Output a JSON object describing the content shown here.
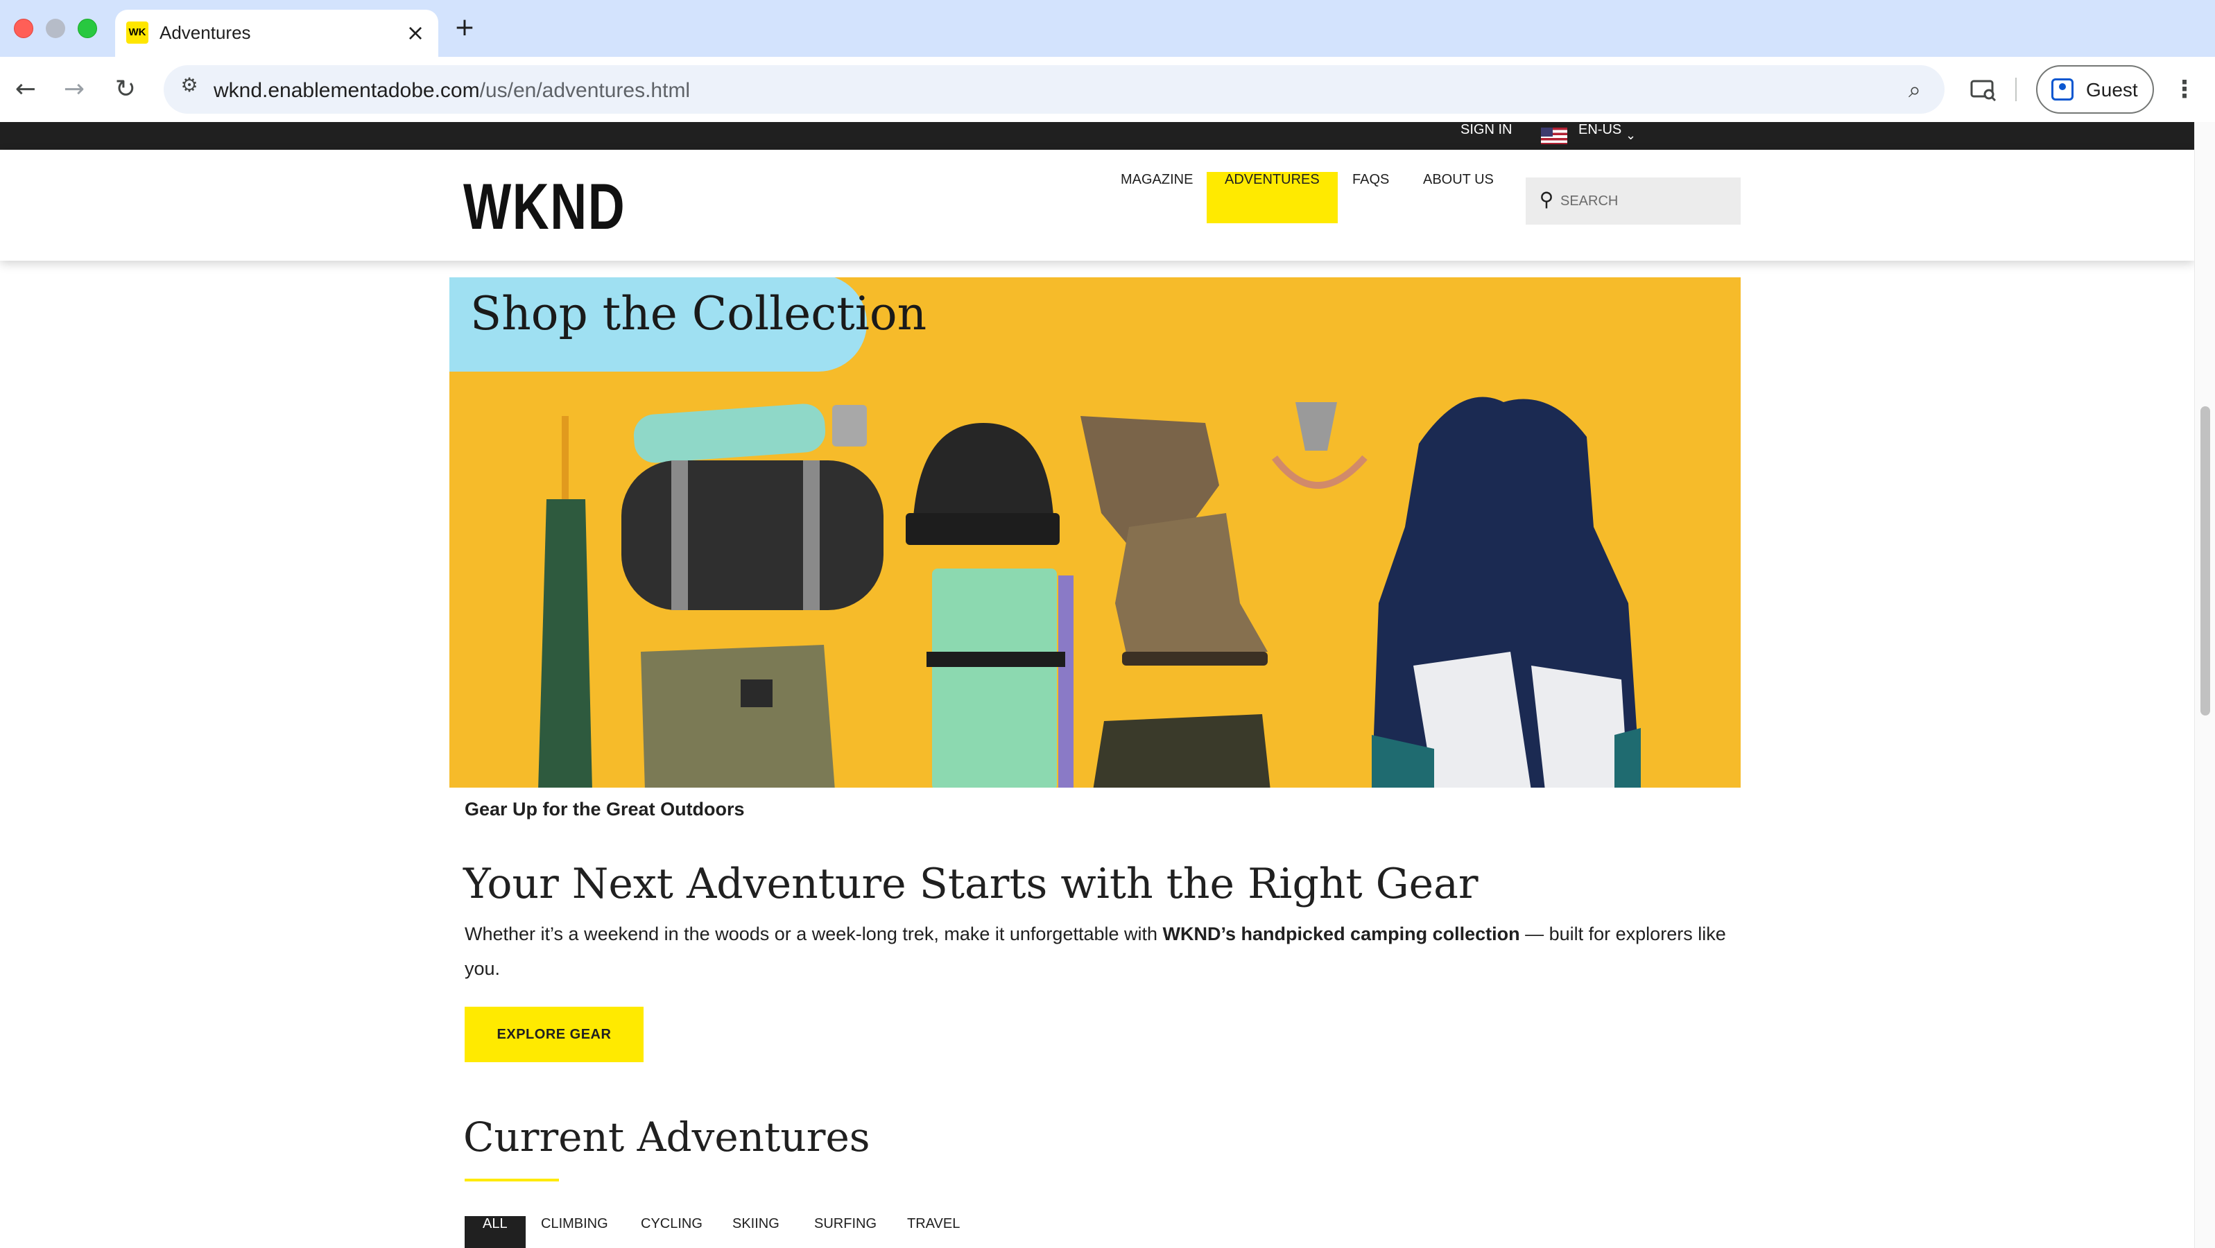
{
  "browser": {
    "tab_title": "Adventures",
    "tab_favicon": "WK",
    "new_tab_icon": "plus-icon",
    "url_host": "wknd.enablementadobe.com",
    "url_path": "/us/en/adventures.html",
    "profile_label": "Guest"
  },
  "utility": {
    "sign_in": "SIGN IN",
    "language": "EN-US"
  },
  "header": {
    "logo": "WKND",
    "nav": [
      "MAGAZINE",
      "ADVENTURES",
      "FAQS",
      "ABOUT US"
    ],
    "active_nav": "ADVENTURES",
    "search_placeholder": "SEARCH"
  },
  "hero": {
    "badge": "Shop the Collection",
    "caption": "Gear Up for the Great Outdoors"
  },
  "intro": {
    "headline": "Your Next Adventure Starts with the Right Gear",
    "body_start": "Whether it’s a weekend in the woods or a week-long trek, make it unforgettable with ",
    "body_bold": "WKND’s handpicked camping collection",
    "body_end": " — built for explorers like you.",
    "cta": "EXPLORE GEAR"
  },
  "adventures": {
    "title": "Current Adventures",
    "filters": [
      "ALL",
      "CLIMBING",
      "CYCLING",
      "SKIING",
      "SURFING",
      "TRAVEL"
    ],
    "active_filter": "ALL"
  },
  "colors": {
    "accent": "#ffea00",
    "hero_bg": "#f6bb2a",
    "badge": "#9fe0f2",
    "dark": "#202020"
  }
}
